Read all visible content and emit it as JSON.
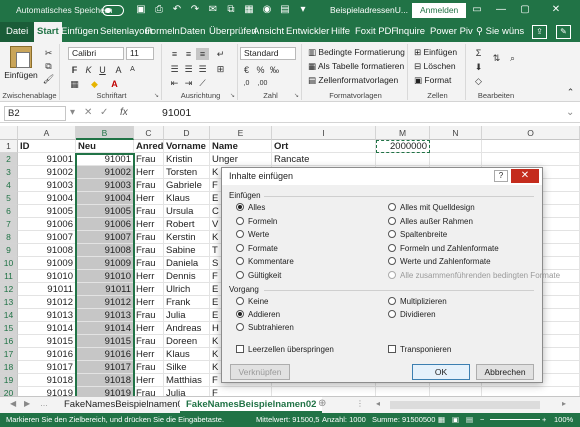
{
  "titlebar": {
    "autosave_label": "Automatisches Speichern",
    "document_name": "BeispieladressenU...",
    "signin_label": "Anmelden"
  },
  "tabs": [
    "Datei",
    "Start",
    "Einfügen",
    "Seitenlayout",
    "Formeln",
    "Daten",
    "Überprüfen",
    "Ansicht",
    "Entwickler",
    "Hilfe",
    "Foxit PDF",
    "Inquire",
    "Power Piv"
  ],
  "active_tab": "Start",
  "tell_me": "Sie wüns",
  "ribbon": {
    "clipboard": {
      "paste_label": "Einfügen",
      "group_label": "Zwischenablage"
    },
    "font": {
      "font_name": "Calibri",
      "font_size": "11",
      "group_label": "Schriftart"
    },
    "alignment": {
      "group_label": "Ausrichtung"
    },
    "number": {
      "format": "Standard",
      "group_label": "Zahl"
    },
    "styles": {
      "cond_format": "Bedingte Formatierung",
      "as_table": "Als Tabelle formatieren",
      "cell_styles": "Zellenformatvorlagen",
      "group_label": "Formatvorlagen"
    },
    "cells": {
      "insert": "Einfügen",
      "delete": "Löschen",
      "format": "Format",
      "group_label": "Zellen"
    },
    "editing": {
      "group_label": "Bearbeiten"
    }
  },
  "formula_bar": {
    "name_box": "B2",
    "fx": "fx",
    "value": "91001"
  },
  "columns": [
    "A",
    "B",
    "C",
    "D",
    "E",
    "I",
    "M",
    "N",
    "O"
  ],
  "header_row": {
    "num": "1",
    "A": "ID",
    "B": "Neu",
    "C": "Anrede",
    "D": "Vorname",
    "E": "Name",
    "I": "Ort",
    "M": "2000000"
  },
  "rows": [
    {
      "num": "2",
      "A": "91001",
      "B": "91001",
      "C": "Frau",
      "D": "Kristin",
      "E": "Unger",
      "I": "Rancate"
    },
    {
      "num": "3",
      "A": "91002",
      "B": "91002",
      "C": "Herr",
      "D": "Torsten",
      "E": "K",
      "I": ""
    },
    {
      "num": "4",
      "A": "91003",
      "B": "91003",
      "C": "Frau",
      "D": "Gabriele",
      "E": "F",
      "I": ""
    },
    {
      "num": "5",
      "A": "91004",
      "B": "91004",
      "C": "Herr",
      "D": "Klaus",
      "E": "E",
      "I": ""
    },
    {
      "num": "6",
      "A": "91005",
      "B": "91005",
      "C": "Frau",
      "D": "Ursula",
      "E": "C",
      "I": ""
    },
    {
      "num": "7",
      "A": "91006",
      "B": "91006",
      "C": "Herr",
      "D": "Robert",
      "E": "V",
      "I": ""
    },
    {
      "num": "8",
      "A": "91007",
      "B": "91007",
      "C": "Frau",
      "D": "Kerstin",
      "E": "K",
      "I": ""
    },
    {
      "num": "9",
      "A": "91008",
      "B": "91008",
      "C": "Frau",
      "D": "Sabine",
      "E": "T",
      "I": ""
    },
    {
      "num": "10",
      "A": "91009",
      "B": "91009",
      "C": "Frau",
      "D": "Daniela",
      "E": "S",
      "I": ""
    },
    {
      "num": "11",
      "A": "91010",
      "B": "91010",
      "C": "Herr",
      "D": "Dennis",
      "E": "F",
      "I": ""
    },
    {
      "num": "12",
      "A": "91011",
      "B": "91011",
      "C": "Herr",
      "D": "Ulrich",
      "E": "E",
      "I": ""
    },
    {
      "num": "13",
      "A": "91012",
      "B": "91012",
      "C": "Herr",
      "D": "Frank",
      "E": "E",
      "I": ""
    },
    {
      "num": "14",
      "A": "91013",
      "B": "91013",
      "C": "Frau",
      "D": "Julia",
      "E": "E",
      "I": ""
    },
    {
      "num": "15",
      "A": "91014",
      "B": "91014",
      "C": "Herr",
      "D": "Andreas",
      "E": "H",
      "I": ""
    },
    {
      "num": "16",
      "A": "91015",
      "B": "91015",
      "C": "Frau",
      "D": "Doreen",
      "E": "K",
      "I": ""
    },
    {
      "num": "17",
      "A": "91016",
      "B": "91016",
      "C": "Herr",
      "D": "Klaus",
      "E": "K",
      "I": ""
    },
    {
      "num": "18",
      "A": "91017",
      "B": "91017",
      "C": "Frau",
      "D": "Silke",
      "E": "K",
      "I": ""
    },
    {
      "num": "19",
      "A": "91018",
      "B": "91018",
      "C": "Herr",
      "D": "Matthias",
      "E": "F",
      "I": ""
    },
    {
      "num": "20",
      "A": "91019",
      "B": "91019",
      "C": "Frau",
      "D": "Julia",
      "E": "F",
      "I": ""
    },
    {
      "num": "21",
      "A": "91020",
      "B": "91020",
      "C": "Herr",
      "D": "Leon",
      "E": "Böhm",
      "I": "Krummenau"
    }
  ],
  "sheets": [
    "FakeNamesBeispielnamen01",
    "FakeNamesBeispielnamen02"
  ],
  "active_sheet": "FakeNamesBeispielnamen02",
  "status": {
    "message": "Markieren Sie den Zielbereich, und drücken Sie die Eingabetaste.",
    "average": "Mittelwert: 91500,5",
    "count": "Anzahl: 1000",
    "sum": "Summe: 91500500",
    "zoom": "100%"
  },
  "dialog": {
    "title": "Inhalte einfügen",
    "paste_section": "Einfügen",
    "paste_options_left": [
      "Alles",
      "Formeln",
      "Werte",
      "Formate",
      "Kommentare",
      "Gültigkeit"
    ],
    "paste_options_right": [
      "Alles mit Quelldesign",
      "Alles außer Rahmen",
      "Spaltenbreite",
      "Formeln und Zahlenformate",
      "Werte und Zahlenformate",
      "Alle zusammenführenden bedingten Formate"
    ],
    "selected_paste": "Alles",
    "operation_section": "Vorgang",
    "operation_left": [
      "Keine",
      "Addieren",
      "Subtrahieren"
    ],
    "operation_right": [
      "Multiplizieren",
      "Dividieren"
    ],
    "selected_operation": "Addieren",
    "skip_blanks": "Leerzellen überspringen",
    "transpose": "Transponieren",
    "link_button": "Verknüpfen",
    "ok_button": "OK",
    "cancel_button": "Abbrechen",
    "help": "?",
    "close": "✕"
  }
}
